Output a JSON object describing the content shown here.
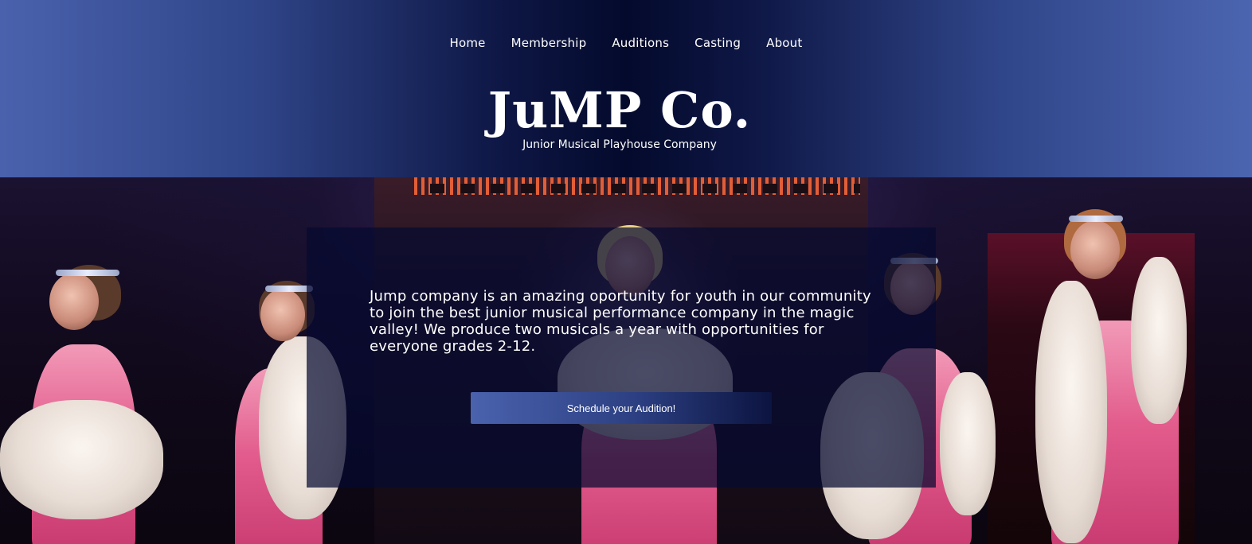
{
  "nav": {
    "items": [
      {
        "label": "Home"
      },
      {
        "label": "Membership"
      },
      {
        "label": "Auditions"
      },
      {
        "label": "Casting"
      },
      {
        "label": "About"
      }
    ]
  },
  "brand": {
    "logo": "JuMP Co.",
    "tagline": "Junior Musical Playhouse Company"
  },
  "hero": {
    "intro": "Jump company is an amazing oportunity for youth in our community to join the best junior musical performance company in the magic valley! We produce two musicals a year with opportunities for everyone grades 2-12.",
    "cta_label": "Schedule your Audition!"
  },
  "colors": {
    "header_edge": "#4a62ad",
    "header_center": "#040a2c",
    "panel": "#060a30",
    "dress_pink": "#e25c8c"
  }
}
